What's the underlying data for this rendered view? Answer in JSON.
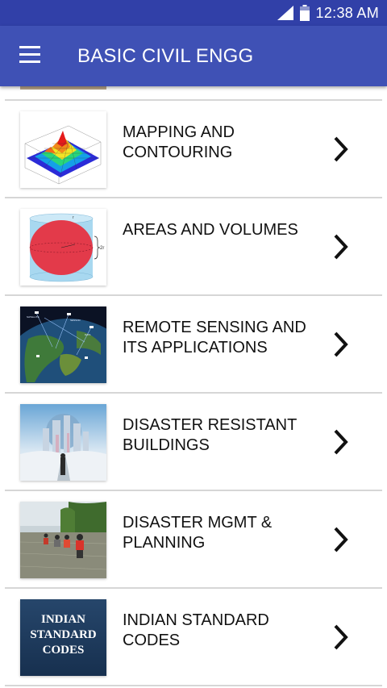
{
  "status_bar": {
    "time": "12:38 AM"
  },
  "app_bar": {
    "title": "BASIC CIVIL ENGG"
  },
  "items": [
    {
      "label": "MAPPING AND CONTOURING",
      "thumb": "3d-surface-plot"
    },
    {
      "label": "AREAS AND VOLUMES",
      "thumb": "cylinder-sphere-diagram"
    },
    {
      "label": "REMOTE SENSING AND ITS APPLICATIONS",
      "thumb": "earth-satellite-map"
    },
    {
      "label": "DISASTER RESISTANT BUILDINGS",
      "thumb": "futuristic-city-globe"
    },
    {
      "label": "DISASTER MGMT & PLANNING",
      "thumb": "flood-rescue-photo"
    },
    {
      "label": "INDIAN STANDARD CODES",
      "thumb": "indian-standard-codes-card",
      "thumb_text": "INDIAN STANDARD CODES"
    }
  ],
  "colors": {
    "status_bar": "#3140a8",
    "app_bar": "#3f51b5"
  }
}
